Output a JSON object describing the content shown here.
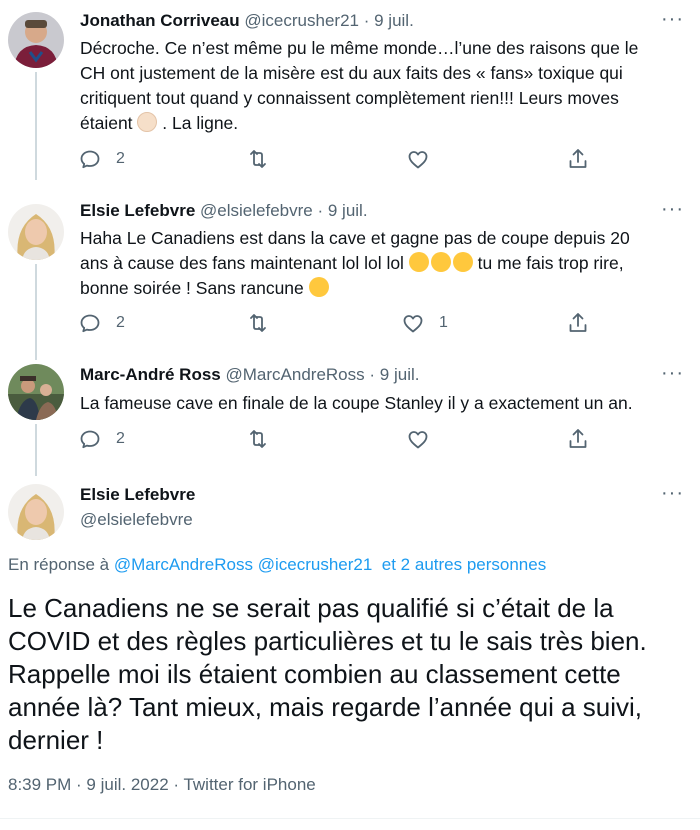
{
  "tweets": [
    {
      "name": "Jonathan Corriveau",
      "handle": "@icecrusher21",
      "dot": "·",
      "date": "9 juil.",
      "more": "···",
      "text1": "Décroche. Ce n’est même pu le même monde…l’une des raisons que le CH ont justement de la misère est du aux faits des « fans» toxique qui critiquent tout quand y connaissent complètement rien!!! Leurs moves étaient ",
      "text2": " . La ligne.",
      "replies": "2",
      "retweets": "",
      "likes": ""
    },
    {
      "name": "Elsie Lefebvre",
      "handle": "@elsielefebvre",
      "dot": "·",
      "date": "9 juil.",
      "more": "···",
      "text1": "Haha Le Canadiens est dans la cave et gagne pas de coupe depuis 20 ans à cause des fans maintenant lol lol lol ",
      "text2": " tu me fais trop rire, bonne soirée ! Sans rancune ",
      "replies": "2",
      "retweets": "",
      "likes": "1"
    },
    {
      "name": "Marc-André Ross",
      "handle": "@MarcAndreRoss",
      "dot": "·",
      "date": "9 juil.",
      "more": "···",
      "text1": "La fameuse cave en finale de la coupe Stanley il y a exactement un an.",
      "replies": "2",
      "retweets": "",
      "likes": ""
    }
  ],
  "main": {
    "name": "Elsie Lefebvre",
    "handle": "@elsielefebvre",
    "more": "···",
    "reply_prefix": "En réponse à ",
    "mention1": "@MarcAndreRoss",
    "mention2": "@icecrusher21",
    "mention3": "et 2 autres personnes",
    "text": "Le Canadiens ne se serait pas qualifié si c’était de la COVID et des règles particulières et tu le sais très bien. Rappelle moi ils étaient combien au classement cette année là? Tant mieux, mais regarde l’année qui a suivi, dernier !",
    "meta": "8:39 PM · 9 juil. 2022 · Twitter for iPhone"
  },
  "colors": {
    "text": "#0f1419",
    "secondary": "#536471",
    "link": "#1d9bf0",
    "thread_line": "#cfd9de"
  },
  "icons": [
    "reply-icon",
    "retweet-icon",
    "like-icon",
    "share-icon",
    "more-icon"
  ]
}
